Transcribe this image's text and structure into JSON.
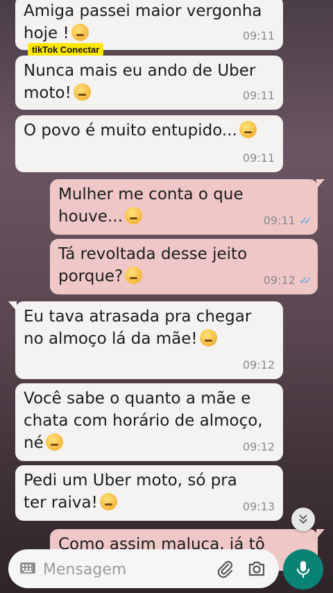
{
  "watermark": "tikTok Conectar",
  "messages": [
    {
      "direction": "in",
      "text": "Amiga passei maior vergonha\nhoje !",
      "emoji": "crying-face",
      "time": "09:11"
    },
    {
      "direction": "in",
      "text": "Nunca mais eu ando de Uber\nmoto!",
      "emoji": "confused-face",
      "time": "09:11"
    },
    {
      "direction": "in",
      "text": "O povo é muito entupido...",
      "emoji": "unamused-face",
      "time": "09:11"
    },
    {
      "direction": "out",
      "text": "Mulher me conta o que\nhouve...",
      "emoji": "hushed-face",
      "time": "09:11",
      "status": "read"
    },
    {
      "direction": "out",
      "text": "Tá revoltada desse jeito\nporque?",
      "emoji": "face-with-raised-eyebrow",
      "time": "09:12",
      "status": "read"
    },
    {
      "direction": "in",
      "text": "Eu tava atrasada pra chegar\nno almoço lá da mãe!",
      "emoji": "face-with-steam",
      "time": "09:12"
    },
    {
      "direction": "in",
      "text": "Você sabe o quanto a mãe e\nchata com horário de almoço,\nné",
      "emoji": "unamused-face",
      "time": "09:12"
    },
    {
      "direction": "in",
      "text": "Pedi um Uber moto,  só pra\nter raiva!",
      "emoji": "face-with-steam",
      "time": "09:13"
    },
    {
      "direction": "out",
      "text": "Como assim maluca, já tô",
      "emoji": "",
      "time": "",
      "status": "partial"
    }
  ],
  "read_ticks": "✓✓",
  "input": {
    "placeholder": "Mensagem",
    "value": ""
  },
  "icons": {
    "keyboard": "keyboard-icon",
    "attach": "paperclip-icon",
    "camera": "camera-icon",
    "mic": "microphone-icon",
    "scroll": "double-chevron-down-icon"
  },
  "colors": {
    "incoming_bubble": "#f4f3f2",
    "outgoing_bubble": "#f0c7c7",
    "read_ticks": "#4fa7e8",
    "mic_button": "#0a8375"
  }
}
